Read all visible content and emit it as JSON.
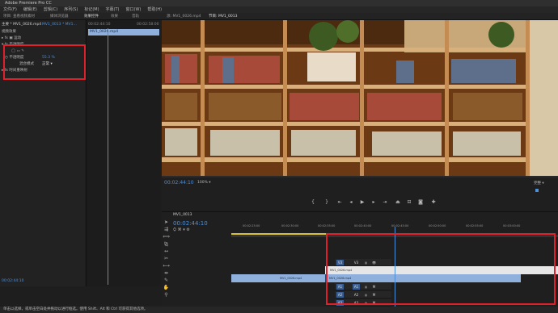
{
  "app": {
    "title": "Adobe Premiere Pro CC",
    "menu": [
      "文件(F)",
      "编辑(E)",
      "剪辑(C)",
      "序列(S)",
      "标记(M)",
      "字幕(T)",
      "窗口(W)",
      "帮助(H)"
    ]
  },
  "top_tabs": {
    "left": [
      "项目: 查看视频素材",
      "媒体浏览器",
      "效果控件",
      "效果",
      "音轨"
    ],
    "source": "源: MV1_0026.mp4",
    "program": "节目: MV1_0013"
  },
  "effect_controls": {
    "master": "主要 * MV1_0026.mp4",
    "sequence": "MV1_0013 * MV1...",
    "clip_label": "MV1_0026.mp4",
    "video_effects": "视频效果",
    "motion": "运动",
    "opacity": "不透明度",
    "opacity_param": "不透明度",
    "opacity_value": "55.3 %",
    "blend_mode_label": "混合模式",
    "blend_mode_value": "正常",
    "time_remap": "时间重映射",
    "ruler_start": "00:02:44:10",
    "ruler_end": "00:02:58:00",
    "timecode": "00:02:44:10"
  },
  "program": {
    "timecode": "00:02:44:10",
    "zoom": "100%",
    "quality": "完整",
    "duration": "00:00:44:10"
  },
  "timeline": {
    "tab": "MV1_0013",
    "timecode": "00:02:44:10",
    "ruler": [
      "00:02:25:00",
      "00:02:30:00",
      "00:02:35:00",
      "00:02:40:00",
      "00:02:45:00",
      "00:02:50:00",
      "00:02:55:00",
      "00:03:00:00"
    ],
    "tracks": [
      "V3",
      "V2",
      "V1",
      "A1",
      "A2",
      "A3"
    ],
    "track_targets": [
      "V3",
      "V2",
      "V1",
      "A1",
      "A2",
      "A3"
    ],
    "clip_v2": "MV1_0026.mp4",
    "clip_v1_a": "MV1_0026.mp4",
    "clip_v1_b": "MV1_0026.mp4"
  },
  "status": {
    "text": "单击以选择，或单击空白处并拖动以进行框选。使用 Shift、Alt 和 Ctrl 可获得其他选项。"
  },
  "colors": {
    "accent": "#4f8fd6",
    "annotation": "#e0202a",
    "clip": "#8fb0dc",
    "clip_v2": "#e6e6e6"
  }
}
